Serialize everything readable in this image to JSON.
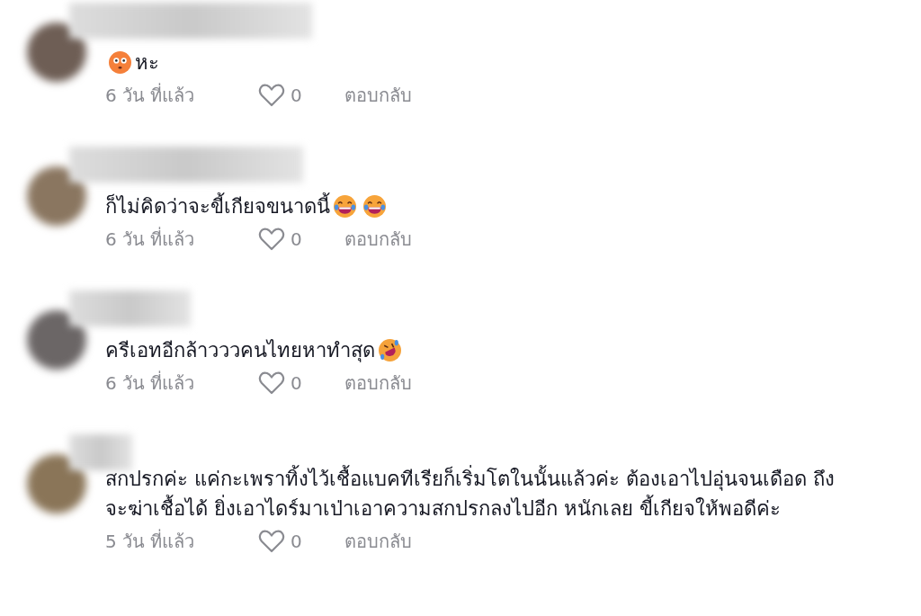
{
  "comments": [
    {
      "parts": [
        {
          "kind": "flushed_emoji"
        },
        {
          "kind": "text",
          "text": "หะ"
        }
      ],
      "time": "6 วัน ที่แล้ว",
      "likes": "0",
      "reply": "ตอบกลับ"
    },
    {
      "parts": [
        {
          "kind": "text",
          "text": "ก็ไม่คิดว่าจะขี้เกียจขนาดนี้"
        },
        {
          "kind": "laughing_emoji"
        },
        {
          "kind": "laughing_emoji"
        }
      ],
      "time": "6 วัน ที่แล้ว",
      "likes": "0",
      "reply": "ตอบกลับ"
    },
    {
      "parts": [
        {
          "kind": "text",
          "text": "ครีเอทอีกล้าวววคนไทยหาทำสุด"
        },
        {
          "kind": "rofl_emoji"
        }
      ],
      "time": "6 วัน ที่แล้ว",
      "likes": "0",
      "reply": "ตอบกลับ"
    },
    {
      "parts": [
        {
          "kind": "text",
          "text": "สกปรกค่ะ แค่กะเพราทิ้งไว้เชื้อแบคทีเรียก็เริ่มโตในนั้นแล้วค่ะ ต้องเอาไปอุ่นจนเดือด ถึงจะฆ่าเชื้อได้ ยิ่งเอาไดร์มาเป่าเอาความสกปรกลงไปอีก หนักเลย ขี้เกียจให้พอดีค่ะ"
        }
      ],
      "time": "5 วัน ที่แล้ว",
      "likes": "0",
      "reply": "ตอบกลับ"
    }
  ]
}
